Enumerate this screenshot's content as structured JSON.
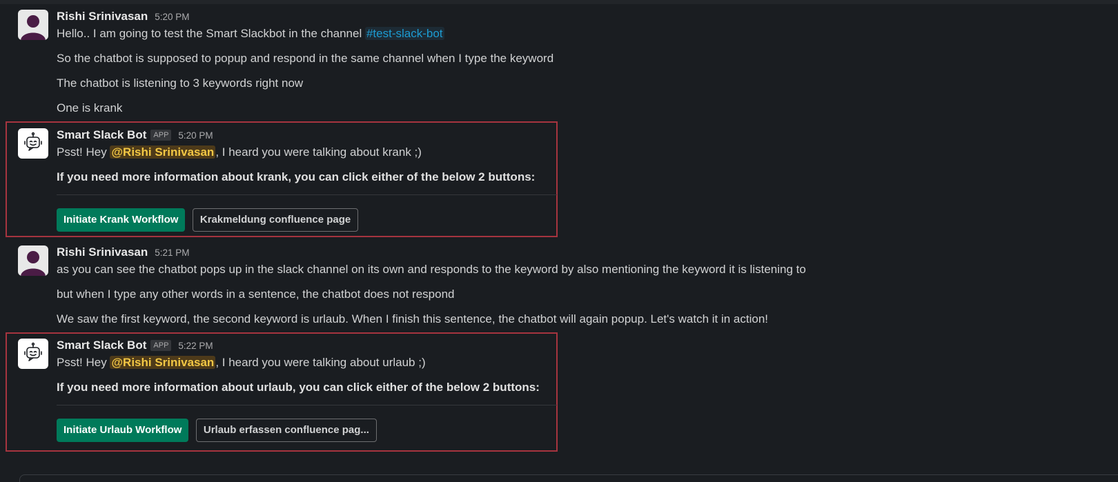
{
  "messages": [
    {
      "author": "Rishi Srinivasan",
      "time": "5:20 PM",
      "line1_text": "Hello.. I am going to test the Smart Slackbot in the channel ",
      "line1_channel": "#test-slack-bot",
      "line2": "So the chatbot is supposed to popup and respond in the same channel when I type the keyword",
      "line3": "The chatbot is listening to 3 keywords right now",
      "line4": "One is krank"
    },
    {
      "author": "Smart Slack Bot",
      "badge": "APP",
      "time": "5:20 PM",
      "line1_pre": "Psst! Hey ",
      "mention": "@Rishi Srinivasan",
      "line1_post": ", I heard you were talking about krank ;)",
      "bold_line": "If you need more information about krank, you can click either of the below 2 buttons:",
      "primary_button": "Initiate Krank Workflow",
      "secondary_button": "Krakmeldung confluence page"
    },
    {
      "author": "Rishi Srinivasan",
      "time": "5:21 PM",
      "line1": "as you can see the chatbot pops up in the slack channel on its own and responds to the keyword by also mentioning the keyword it is listening to",
      "line2": "but when I type any other words in a sentence, the chatbot does not respond",
      "line3": "We saw the first keyword, the second keyword is urlaub. When I finish this sentence, the chatbot will again popup. Let's watch it in action!"
    },
    {
      "author": "Smart Slack Bot",
      "badge": "APP",
      "time": "5:22 PM",
      "line1_pre": "Psst! Hey ",
      "mention": "@Rishi Srinivasan",
      "line1_post": ", I heard you were talking about urlaub ;)",
      "bold_line": "If you need more information about urlaub, you can click either of the below 2 buttons:",
      "primary_button": "Initiate Urlaub Workflow",
      "secondary_button": "Urlaub erfassen confluence pag..."
    }
  ],
  "colors": {
    "background": "#1a1d21",
    "primary_button": "#007a5a",
    "highlight_box": "#a6343f",
    "mention_text": "#f2c744",
    "channel_link": "#1d9bd1"
  },
  "icons": {
    "user_avatar": "person-silhouette-icon",
    "bot_avatar": "robot-face-icon"
  }
}
